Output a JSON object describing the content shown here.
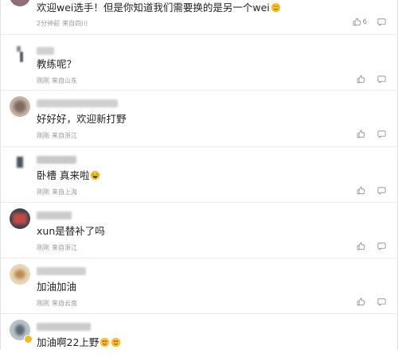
{
  "icons": {
    "like": "thumb-up-icon",
    "reply": "speech-bubble-icon",
    "emoji": "emoji-icon",
    "verified": "verified-badge-icon"
  },
  "colors": {
    "meta": "#9a9a9a",
    "divider": "#ececec",
    "emoji": "#f6c234",
    "heart": "#e8455a"
  },
  "comments": [
    {
      "text": "欢迎wei选手！但是你知道我们需要换的是另一个wei",
      "time": "2分钟前",
      "location": "来自四川",
      "likes": "6"
    },
    {
      "text": "教练呢？",
      "time": "刚刚",
      "location": "来自山东",
      "likes": ""
    },
    {
      "text": "好好好，欢迎新打野",
      "time": "刚刚",
      "location": "来自浙江",
      "likes": ""
    },
    {
      "text": "卧槽 真来啦",
      "time": "刚刚",
      "location": "来自上海",
      "likes": ""
    },
    {
      "text": "xun是替补了吗",
      "time": "刚刚",
      "location": "来自浙江",
      "likes": ""
    },
    {
      "text": "加油加油",
      "time": "刚刚",
      "location": "来自云南",
      "likes": ""
    },
    {
      "text": "加油啊22上野",
      "time": "",
      "location": "",
      "likes": ""
    }
  ]
}
